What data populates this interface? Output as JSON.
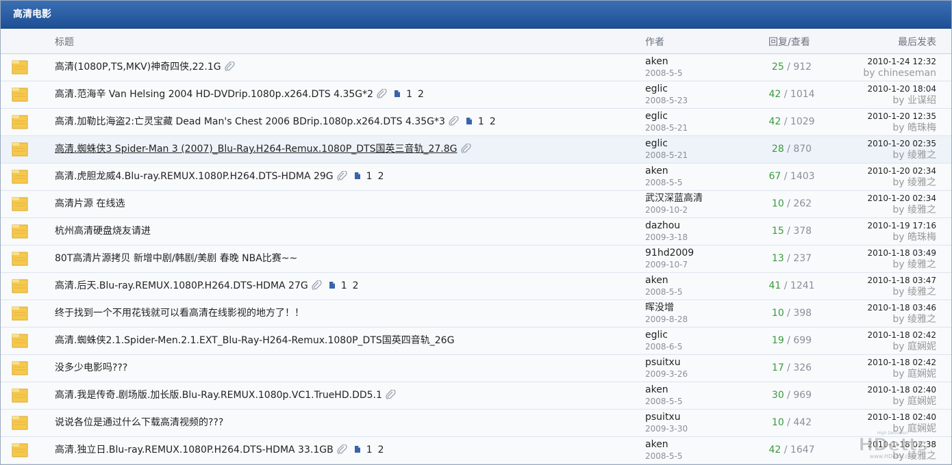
{
  "forum_title": "高清电影",
  "columns": {
    "title": "标题",
    "author": "作者",
    "stats": "回复/查看",
    "last": "最后发表"
  },
  "by_prefix": "by",
  "rows": [
    {
      "title": "高清(1080P,TS,MKV)神奇四侠,22.1G",
      "attach": true,
      "pages": [],
      "author": "aken",
      "author_date": "2008-5-5",
      "replies": "25",
      "views": "912",
      "last_date": "2010-1-24 12:32",
      "last_by": "chineseman"
    },
    {
      "title": "高清.范海辛 Van Helsing 2004 HD-DVDrip.1080p.x264.DTS 4.35G*2",
      "attach": true,
      "pages": [
        "1",
        "2"
      ],
      "author": "eglic",
      "author_date": "2008-5-23",
      "replies": "42",
      "views": "1014",
      "last_date": "2010-1-20 18:04",
      "last_by": "业谋绍"
    },
    {
      "title": "高清.加勒比海盗2:亡灵宝藏 Dead Man's Chest 2006 BDrip.1080p.x264.DTS 4.35G*3",
      "attach": true,
      "pages": [
        "1",
        "2"
      ],
      "author": "eglic",
      "author_date": "2008-5-21",
      "replies": "42",
      "views": "1029",
      "last_date": "2010-1-20 12:35",
      "last_by": "皓珠梅"
    },
    {
      "title": "高清.蜘蛛侠3 Spider-Man 3 (2007)_Blu-Ray.H264-Remux.1080P_DTS国英三音轨_27.8G",
      "attach": true,
      "pages": [],
      "author": "eglic",
      "author_date": "2008-5-21",
      "replies": "28",
      "views": "870",
      "last_date": "2010-1-20 02:35",
      "last_by": "绫雅之",
      "highlight": true
    },
    {
      "title": "高清.虎胆龙威4.Blu-ray.REMUX.1080P.H264.DTS-HDMA 29G",
      "attach": true,
      "pages": [
        "1",
        "2"
      ],
      "author": "aken",
      "author_date": "2008-5-5",
      "replies": "67",
      "views": "1403",
      "last_date": "2010-1-20 02:34",
      "last_by": "绫雅之"
    },
    {
      "title": "高清片源 在线选",
      "attach": false,
      "pages": [],
      "author": "武汉深蓝高清",
      "author_date": "2009-10-2",
      "replies": "10",
      "views": "262",
      "last_date": "2010-1-20 02:34",
      "last_by": "绫雅之"
    },
    {
      "title": "杭州高清硬盘烧友请进",
      "attach": false,
      "pages": [],
      "author": "dazhou",
      "author_date": "2009-3-18",
      "replies": "15",
      "views": "378",
      "last_date": "2010-1-19 17:16",
      "last_by": "皓珠梅"
    },
    {
      "title": "80T高清片源拷贝 新增中剧/韩剧/美剧 春晚 NBA比赛~~",
      "attach": false,
      "pages": [],
      "author": "91hd2009",
      "author_date": "2009-10-7",
      "replies": "13",
      "views": "237",
      "last_date": "2010-1-18 03:49",
      "last_by": "绫雅之"
    },
    {
      "title": "高清.后天.Blu-ray.REMUX.1080P.H264.DTS-HDMA 27G",
      "attach": true,
      "pages": [
        "1",
        "2"
      ],
      "author": "aken",
      "author_date": "2008-5-5",
      "replies": "41",
      "views": "1241",
      "last_date": "2010-1-18 03:47",
      "last_by": "绫雅之"
    },
    {
      "title": "终于找到一个不用花钱就可以看高清在线影视的地方了！！",
      "attach": false,
      "pages": [],
      "author": "晖没增",
      "author_date": "2009-8-28",
      "replies": "10",
      "views": "398",
      "last_date": "2010-1-18 03:46",
      "last_by": "绫雅之"
    },
    {
      "title": "高清.蜘蛛侠2.1.Spider-Men.2.1.EXT_Blu-Ray-H264-Remux.1080P_DTS国英四音轨_26G",
      "attach": false,
      "pages": [],
      "author": "eglic",
      "author_date": "2008-6-5",
      "replies": "19",
      "views": "699",
      "last_date": "2010-1-18 02:42",
      "last_by": "庭娴妮"
    },
    {
      "title": "没多少电影吗???",
      "attach": false,
      "pages": [],
      "author": "psuitxu",
      "author_date": "2009-3-26",
      "replies": "17",
      "views": "326",
      "last_date": "2010-1-18 02:42",
      "last_by": "庭娴妮"
    },
    {
      "title": "高清.我是传奇.剧场版.加长版.Blu-Ray.REMUX.1080p.VC1.TrueHD.DD5.1",
      "attach": true,
      "pages": [],
      "author": "aken",
      "author_date": "2008-5-5",
      "replies": "30",
      "views": "969",
      "last_date": "2010-1-18 02:40",
      "last_by": "庭娴妮"
    },
    {
      "title": "说说各位是通过什么下载高清视频的???",
      "attach": false,
      "pages": [],
      "author": "psuitxu",
      "author_date": "2009-3-30",
      "replies": "10",
      "views": "442",
      "last_date": "2010-1-18 02:40",
      "last_by": "庭娴妮"
    },
    {
      "title": "高清.独立日.Blu-ray.REMUX.1080P.H264.DTS-HDMA 33.1GB",
      "attach": true,
      "pages": [
        "1",
        "2"
      ],
      "author": "aken",
      "author_date": "2008-5-5",
      "replies": "42",
      "views": "1647",
      "last_date": "2010-1-18 02:38",
      "last_by": "绫雅之"
    }
  ],
  "watermark": {
    "text": "HDetts",
    "subtext": "High Definition",
    "url": "www.HDetts.com"
  },
  "colors": {
    "header_top": "#3b6fb3",
    "header_bottom": "#1d4f94",
    "reply_green": "#3a9a3a",
    "icon_yellow": "#f5c94d"
  }
}
